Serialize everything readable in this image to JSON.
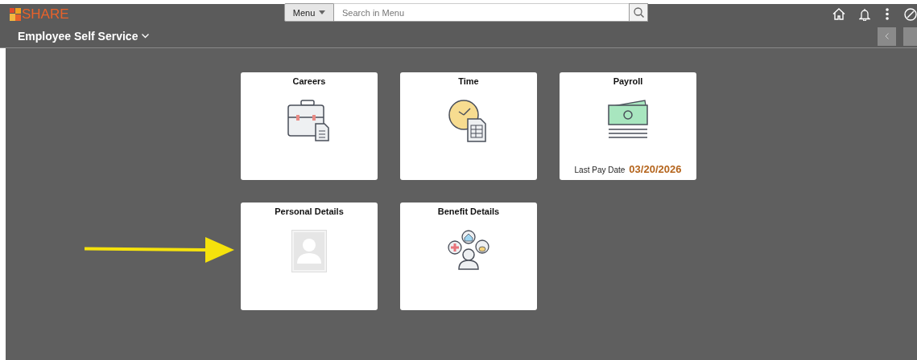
{
  "header": {
    "logo_text": "SHARE",
    "menu_button": "Menu",
    "search": {
      "placeholder": "Search in Menu"
    }
  },
  "title_bar": {
    "title": "Employee Self Service"
  },
  "tiles": [
    {
      "title": "Careers",
      "kind": "careers"
    },
    {
      "title": "Time",
      "kind": "time"
    },
    {
      "title": "Payroll",
      "kind": "payroll",
      "footer": {
        "label": "Last Pay Date",
        "value": "03/20/2026"
      }
    },
    {
      "title": "Personal Details",
      "kind": "personal"
    },
    {
      "title": "Benefit Details",
      "kind": "benefits"
    }
  ]
}
